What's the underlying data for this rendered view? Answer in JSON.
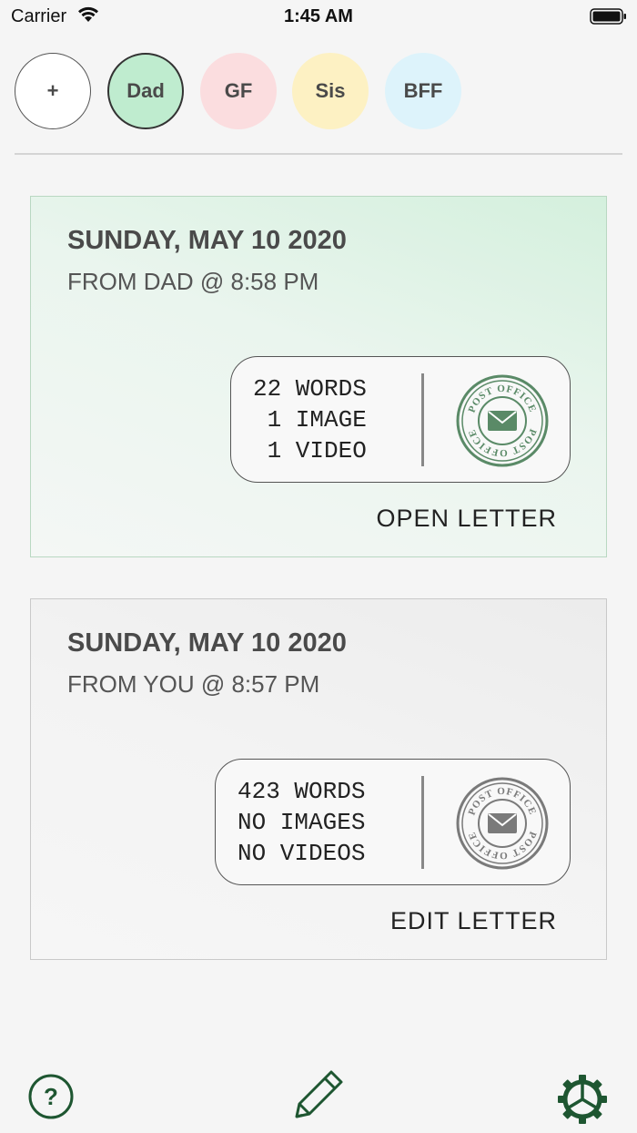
{
  "status_bar": {
    "carrier": "Carrier",
    "time": "1:45 AM"
  },
  "contacts": [
    {
      "label": "+",
      "color": "#ffffff",
      "selected": false
    },
    {
      "label": "Dad",
      "color": "#bfeccf",
      "selected": true
    },
    {
      "label": "GF",
      "color": "#fbdddf",
      "selected": false
    },
    {
      "label": "Sis",
      "color": "#fdf1c3",
      "selected": false
    },
    {
      "label": "BFF",
      "color": "#ddf3fb",
      "selected": false
    }
  ],
  "letters": [
    {
      "date": "SUNDAY, MAY 10 2020",
      "from": "FROM DAD @ 8:58 PM",
      "stats_lines": [
        "22 WORDS",
        " 1 IMAGE",
        " 1 VIDEO"
      ],
      "stamp_text": "POST OFFICE",
      "stamp_color": "#5a8a67",
      "action": "OPEN LETTER"
    },
    {
      "date": "SUNDAY, MAY 10 2020",
      "from": "FROM YOU @ 8:57 PM",
      "stats_lines": [
        "423 WORDS",
        "NO IMAGES",
        "NO VIDEOS"
      ],
      "stamp_text": "POST OFFICE",
      "stamp_color": "#7a7a7a",
      "action": "EDIT LETTER"
    }
  ],
  "toolbar": {
    "help_icon": "question-circle-icon",
    "compose_icon": "pencil-icon",
    "settings_icon": "gear-icon",
    "accent": "#1e5631"
  }
}
